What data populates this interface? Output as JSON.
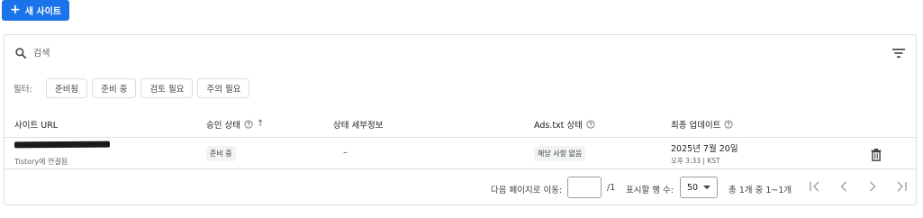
{
  "toolbar": {
    "add_site_label": "새 사이트"
  },
  "search": {
    "placeholder": "검색"
  },
  "filters": {
    "label": "필터:",
    "chips": [
      "준비됨",
      "준비 중",
      "검토 필요",
      "주의 필요"
    ]
  },
  "table": {
    "headers": {
      "site_url": "사이트 URL",
      "approval_status": "승인 상태",
      "status_details": "상태 세부정보",
      "ads_txt_status": "Ads.txt 상태",
      "last_update": "최종 업데이트"
    },
    "rows": [
      {
        "url_redacted": true,
        "subtext": "Tistory에 연결됨",
        "approval_status": "준비 중",
        "status_details": "–",
        "ads_txt_status": "해당 사항 없음",
        "update_date": "2025년 7월 20일",
        "update_time": "오후 3:33 | KST"
      }
    ]
  },
  "pagination": {
    "goto_label": "다음 페이지로 이동:",
    "page_value": "",
    "page_total": "/1",
    "rows_per_page_label": "표시할 행 수:",
    "rows_per_page_value": "50",
    "range_text": "총 1개 중 1~1개"
  },
  "colors": {
    "accent": "#1a73e8",
    "border": "#dadce0",
    "muted_text": "#5f6368"
  },
  "icons": [
    "plus-icon",
    "search-icon",
    "filter-list-icon",
    "help-circle-icon",
    "arrow-up-icon",
    "trash-icon",
    "first-page-icon",
    "chevron-left-icon",
    "chevron-right-icon",
    "last-page-icon"
  ]
}
